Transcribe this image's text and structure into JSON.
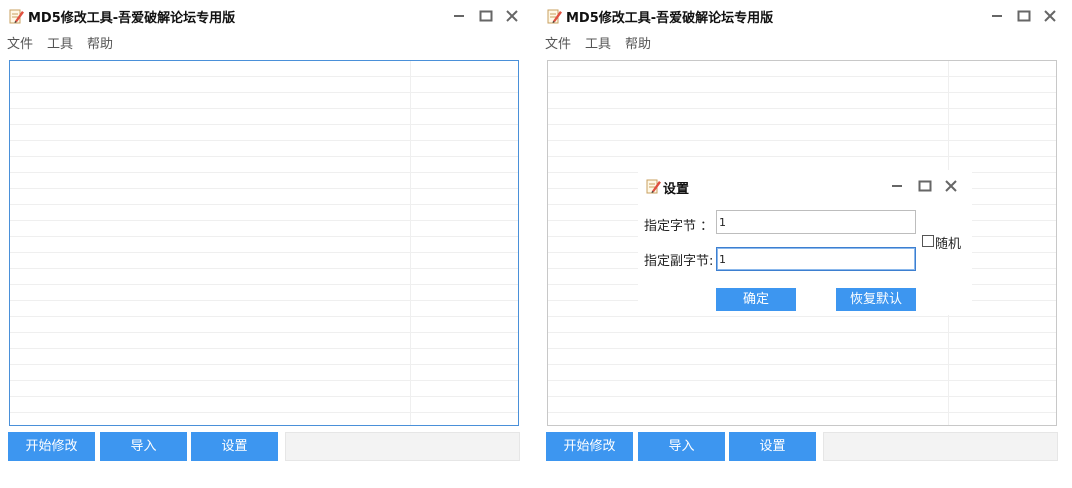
{
  "window": {
    "title": "MD5修改工具-吾爱破解论坛专用版",
    "icon": "notepad-pencil-icon"
  },
  "menu": [
    "文件",
    "工具",
    "帮助"
  ],
  "buttons": {
    "start": "开始修改",
    "import": "导入",
    "settings": "设置"
  },
  "dialog": {
    "title": "设置",
    "byte_label": "指定字节 ：",
    "byte_value": "1",
    "sub_byte_label": "指定副字节:",
    "sub_byte_value": "1",
    "random_label": "随机",
    "random_checked": false,
    "ok": "确定",
    "restore": "恢复默认"
  },
  "colors": {
    "accent": "#3d96f0",
    "focus_border": "#4a90d9"
  }
}
